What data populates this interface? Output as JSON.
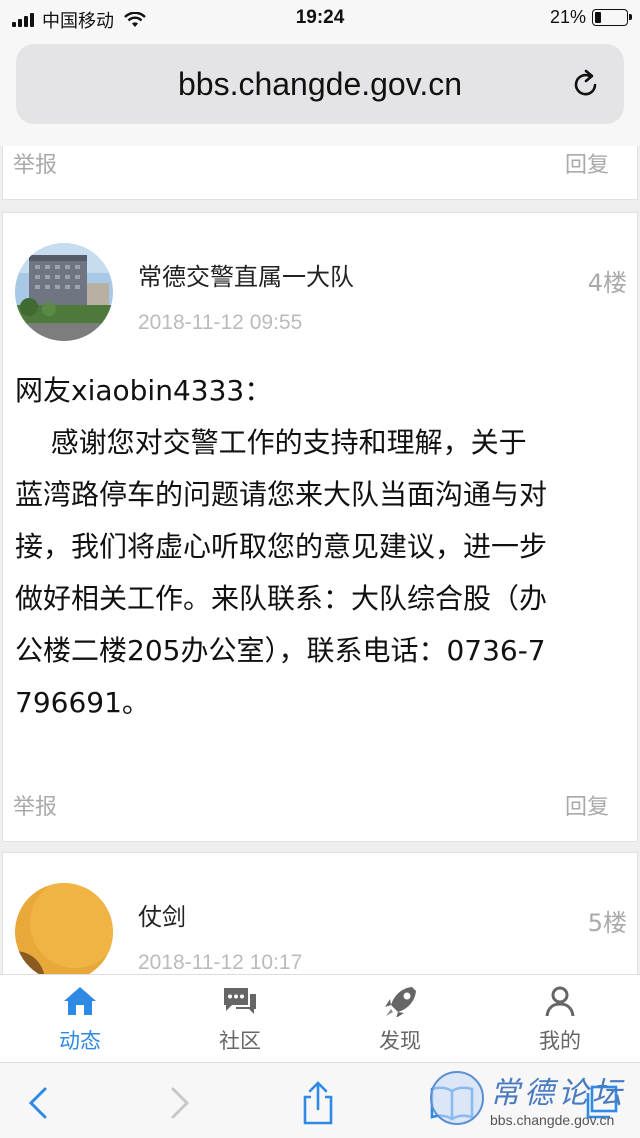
{
  "status_bar": {
    "carrier": "中国移动",
    "time": "19:24",
    "battery_percent": "21%",
    "battery_level": 0.21
  },
  "browser": {
    "url": "bbs.changde.gov.cn",
    "reload_icon": "reload-icon"
  },
  "posts": [
    {
      "report_label": "举报",
      "reply_label": "回复"
    },
    {
      "author": "常德交警直属一大队",
      "date": "2018-11-12 09:55",
      "floor": "4楼",
      "body_lines": [
        "网友xiaobin4333：",
        "    感谢您对交警工作的支持和理解，关于",
        "蓝湾路停车的问题请您来大队当面沟通与对",
        "接，我们将虚心听取您的意见建议，进一步",
        "做好相关工作。来队联系：大队综合股（办",
        "公楼二楼205办公室），联系电话：0736-7",
        "796691。"
      ],
      "report_label": "举报",
      "reply_label": "回复"
    },
    {
      "author": "仗剑",
      "date": "2018-11-12 10:17",
      "floor": "5楼"
    }
  ],
  "tabs": [
    {
      "label": "动态",
      "icon": "home-icon",
      "active": true
    },
    {
      "label": "社区",
      "icon": "chat-icon",
      "active": false
    },
    {
      "label": "发现",
      "icon": "rocket-icon",
      "active": false
    },
    {
      "label": "我的",
      "icon": "user-icon",
      "active": false
    }
  ],
  "watermark": {
    "title": "常德论坛",
    "url": "bbs.changde.gov.cn"
  },
  "colors": {
    "accent": "#2f8ae6"
  }
}
